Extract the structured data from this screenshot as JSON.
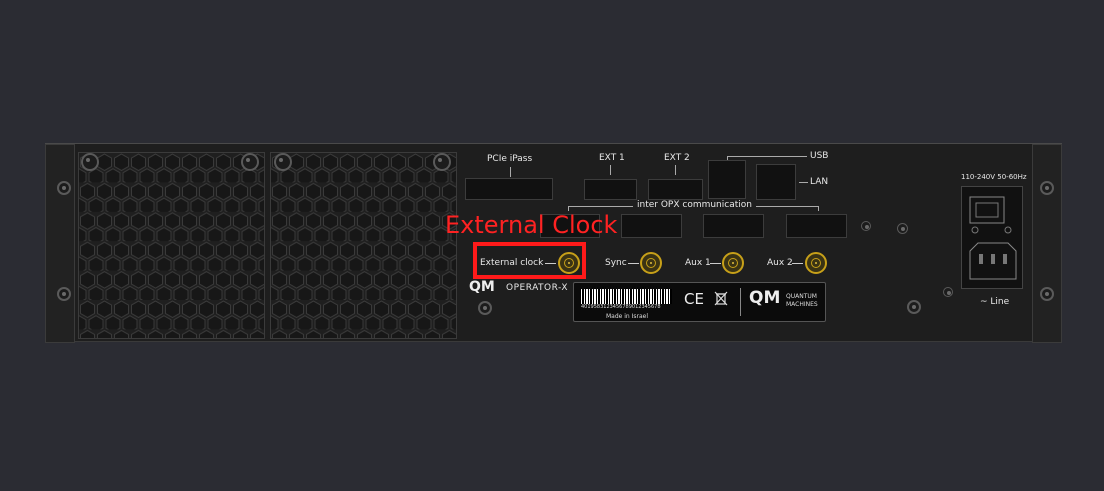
{
  "colors": {
    "background": "#2b2c33",
    "chassis": "#1e1e1e",
    "highlight": "#ff1a1a",
    "coax_gold": "#c7a019"
  },
  "annotation": {
    "label": "External Clock"
  },
  "ports": {
    "pcie_ipass": "PCIe iPass",
    "ext1": "EXT 1",
    "ext2": "EXT 2",
    "usb": "USB",
    "lan": "LAN",
    "inter_opx": "inter OPX communication"
  },
  "connectors": {
    "external_clock": "External clock",
    "sync": "Sync",
    "aux1": "Aux 1",
    "aux2": "Aux 2"
  },
  "branding": {
    "logo_mark": "QM",
    "product": "OPERATOR-X",
    "company_line1": "QUANTUM",
    "company_line2": "MACHINES"
  },
  "sticker": {
    "barcode_number": "4019583123456789012345678",
    "made_in": "Made in Israel",
    "ce_mark": "CE",
    "weee_icon": "crossed-out-bin-icon"
  },
  "power": {
    "rating": "110-240V 50-60Hz",
    "line": "~ Line"
  }
}
